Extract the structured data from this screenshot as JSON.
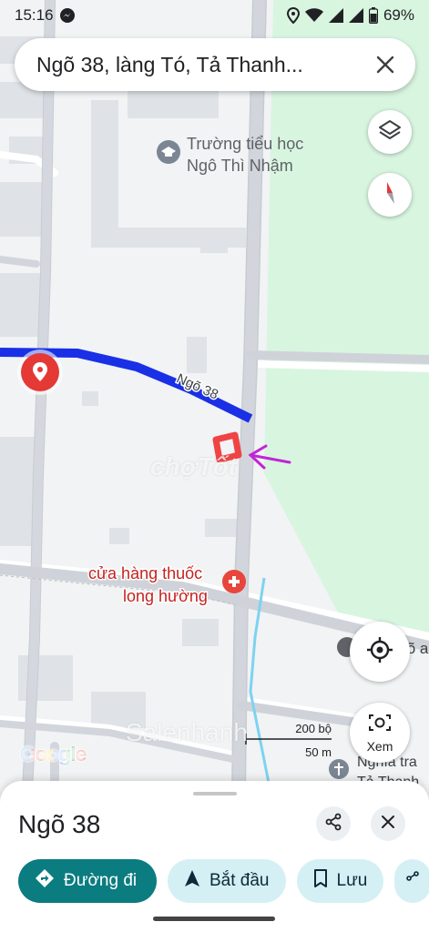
{
  "status_bar": {
    "time": "15:16",
    "battery": "69%"
  },
  "search": {
    "query": "Ngõ 38, làng Tó, Tả Thanh..."
  },
  "map": {
    "poi_school": [
      "Trường tiểu học",
      "Ngô Thì Nhậm"
    ],
    "road_label": "Ngõ 38",
    "poi_pharmacy": [
      "cửa hàng thuốc",
      "long hường"
    ],
    "edge_label_1": "Ngõ a",
    "edge_label_2": [
      "Nghĩa tra",
      "Tả Thanh"
    ],
    "watermark_1": "chợTốt",
    "watermark_2": "Salenhanh",
    "scale": {
      "imperial": "200 bộ",
      "metric": "50 m"
    },
    "logo": "Google",
    "colors": {
      "route": "#1a30e6",
      "park": "#d7f5df",
      "pin": "#e53935",
      "annotation": "#c026d3"
    }
  },
  "controls": {
    "layers_icon": "layers-icon",
    "compass_icon": "compass-icon",
    "location_icon": "my-location-icon",
    "lens_label": "Xem"
  },
  "sheet": {
    "title": "Ngõ 38",
    "actions": {
      "directions": "Đường đi",
      "start": "Bắt đầu",
      "save": "Lưu"
    }
  }
}
